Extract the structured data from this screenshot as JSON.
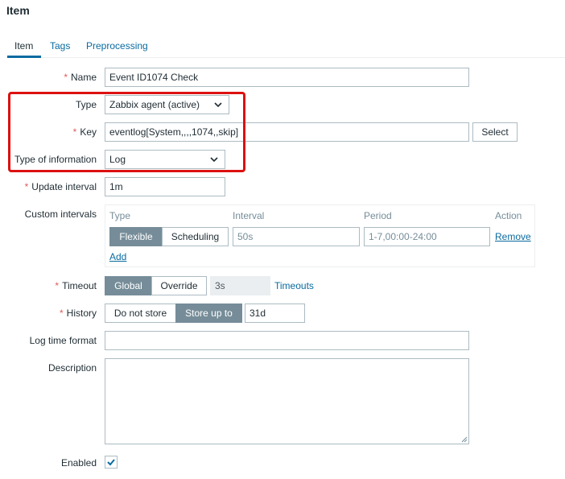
{
  "header": {
    "title": "Item"
  },
  "tabs": [
    {
      "label": "Item",
      "active": true
    },
    {
      "label": "Tags",
      "active": false
    },
    {
      "label": "Preprocessing",
      "active": false
    }
  ],
  "form": {
    "required_marker": "*",
    "name": {
      "label": "Name",
      "value": "Event ID1074 Check"
    },
    "type": {
      "label": "Type",
      "value": "Zabbix agent (active)"
    },
    "key": {
      "label": "Key",
      "value": "eventlog[System,,,,1074,,skip]",
      "select_label": "Select"
    },
    "type_of_information": {
      "label": "Type of information",
      "value": "Log"
    },
    "update_interval": {
      "label": "Update interval",
      "value": "1m"
    },
    "custom_intervals": {
      "label": "Custom intervals",
      "headers": {
        "type": "Type",
        "interval": "Interval",
        "period": "Period",
        "action": "Action"
      },
      "row": {
        "type_options": [
          "Flexible",
          "Scheduling"
        ],
        "type_selected": "Flexible",
        "interval": "50s",
        "period": "1-7,00:00-24:00",
        "remove_label": "Remove"
      },
      "add_label": "Add"
    },
    "timeout": {
      "label": "Timeout",
      "options": [
        "Global",
        "Override"
      ],
      "selected": "Global",
      "value": "3s",
      "link_label": "Timeouts"
    },
    "history": {
      "label": "History",
      "options": [
        "Do not store",
        "Store up to"
      ],
      "selected": "Store up to",
      "value": "31d"
    },
    "log_time_format": {
      "label": "Log time format",
      "value": ""
    },
    "description": {
      "label": "Description",
      "value": ""
    },
    "enabled": {
      "label": "Enabled",
      "checked": true
    }
  },
  "colors": {
    "accent": "#0a6ba0",
    "required": "#e45959",
    "segment_active": "#768d99",
    "highlight_box": "#dd1111"
  }
}
